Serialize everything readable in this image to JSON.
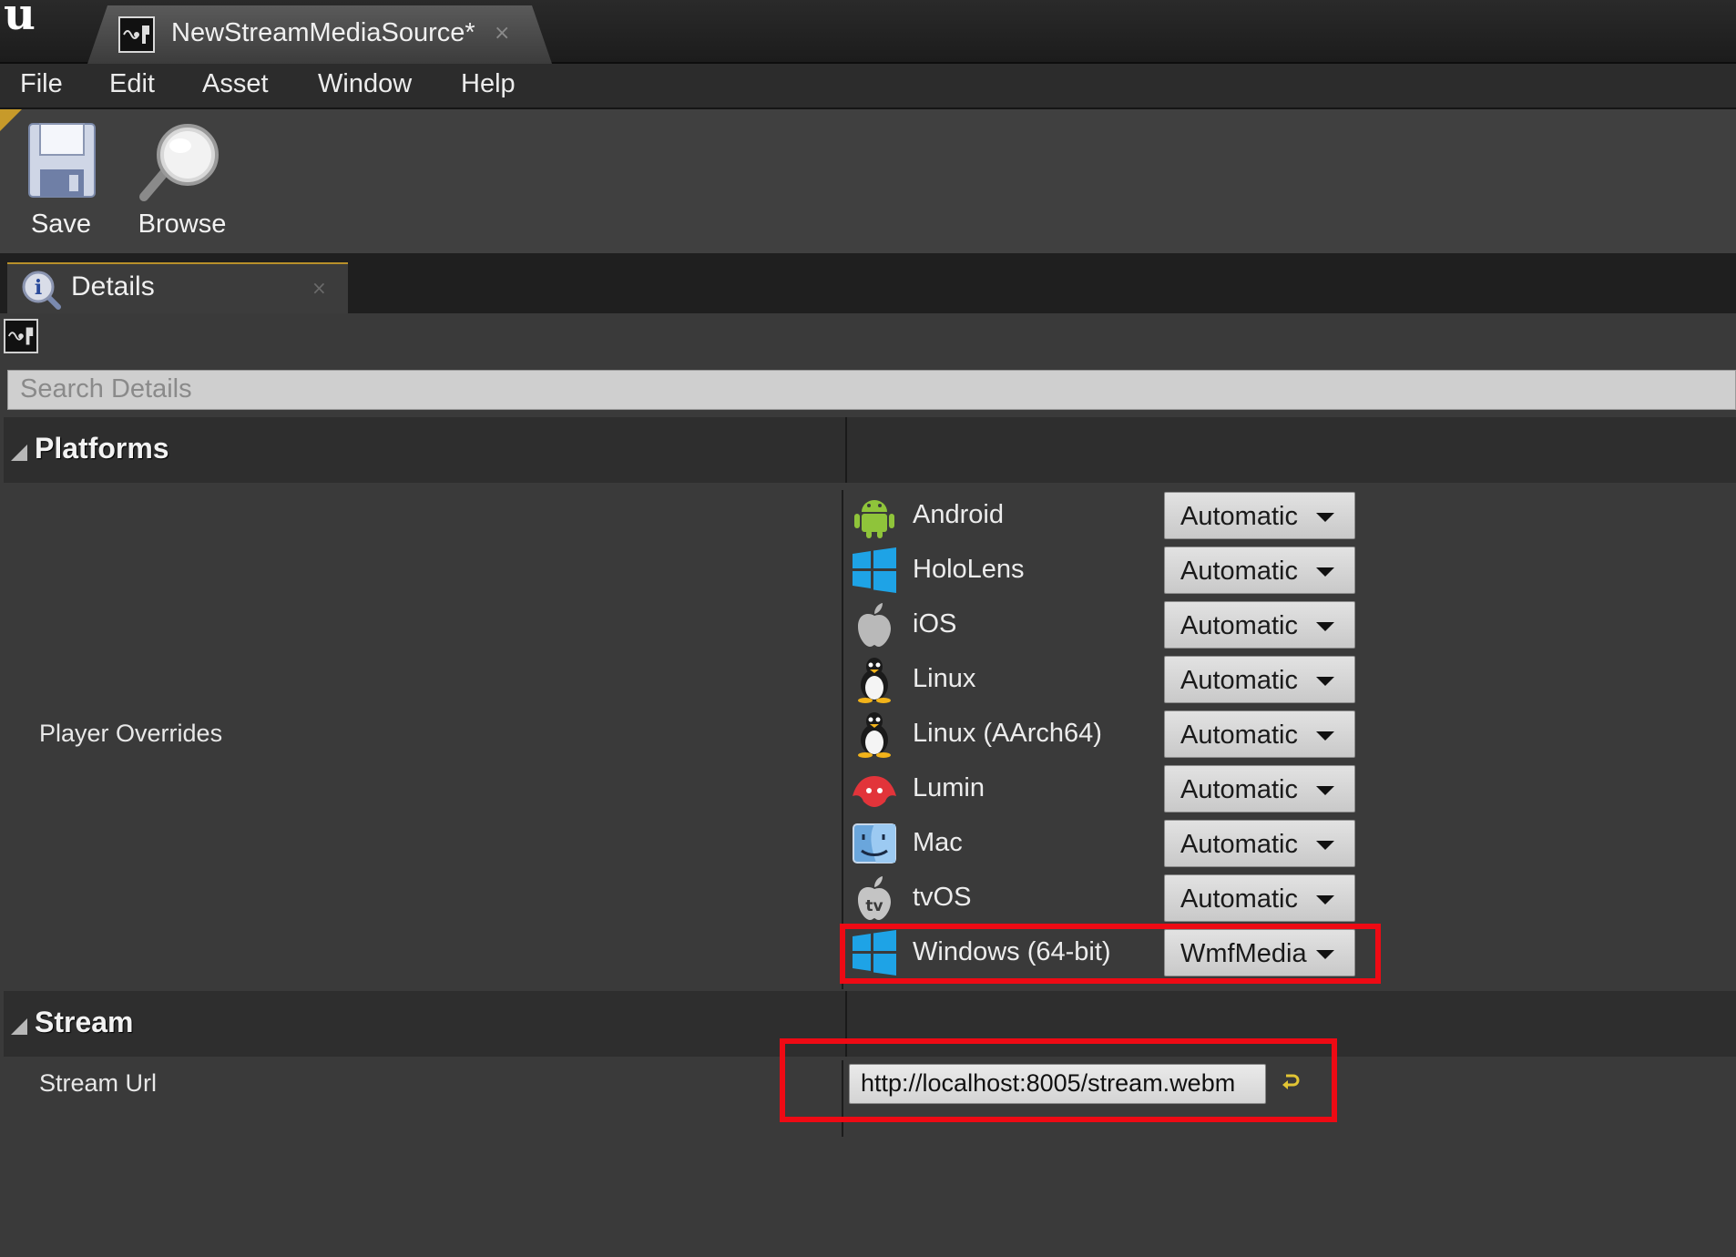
{
  "window": {
    "tab_title": "NewStreamMediaSource*",
    "tab_close": "×"
  },
  "menu": [
    "File",
    "Edit",
    "Asset",
    "Window",
    "Help"
  ],
  "toolbar": {
    "save_label": "Save",
    "browse_label": "Browse"
  },
  "details": {
    "tab_label": "Details",
    "tab_close": "×",
    "search_placeholder": "Search Details"
  },
  "platforms": {
    "category_title": "Platforms",
    "property_label": "Player Overrides",
    "rows": [
      {
        "name": "Android",
        "value": "Automatic",
        "icon": "android-icon"
      },
      {
        "name": "HoloLens",
        "value": "Automatic",
        "icon": "windows-icon"
      },
      {
        "name": "iOS",
        "value": "Automatic",
        "icon": "apple-icon"
      },
      {
        "name": "Linux",
        "value": "Automatic",
        "icon": "linux-icon"
      },
      {
        "name": "Linux (AArch64)",
        "value": "Automatic",
        "icon": "linux-icon"
      },
      {
        "name": "Lumin",
        "value": "Automatic",
        "icon": "lumin-icon"
      },
      {
        "name": "Mac",
        "value": "Automatic",
        "icon": "mac-finder-icon"
      },
      {
        "name": "tvOS",
        "value": "Automatic",
        "icon": "tvos-icon"
      },
      {
        "name": "Windows (64-bit)",
        "value": "WmfMedia",
        "icon": "windows-icon"
      }
    ]
  },
  "stream": {
    "category_title": "Stream",
    "url_label": "Stream Url",
    "url_value": "http://localhost:8005/stream.webm"
  },
  "colors": {
    "highlight": "#ee0a14",
    "accent": "#c79a2a",
    "reset_arrow": "#e2c534"
  }
}
